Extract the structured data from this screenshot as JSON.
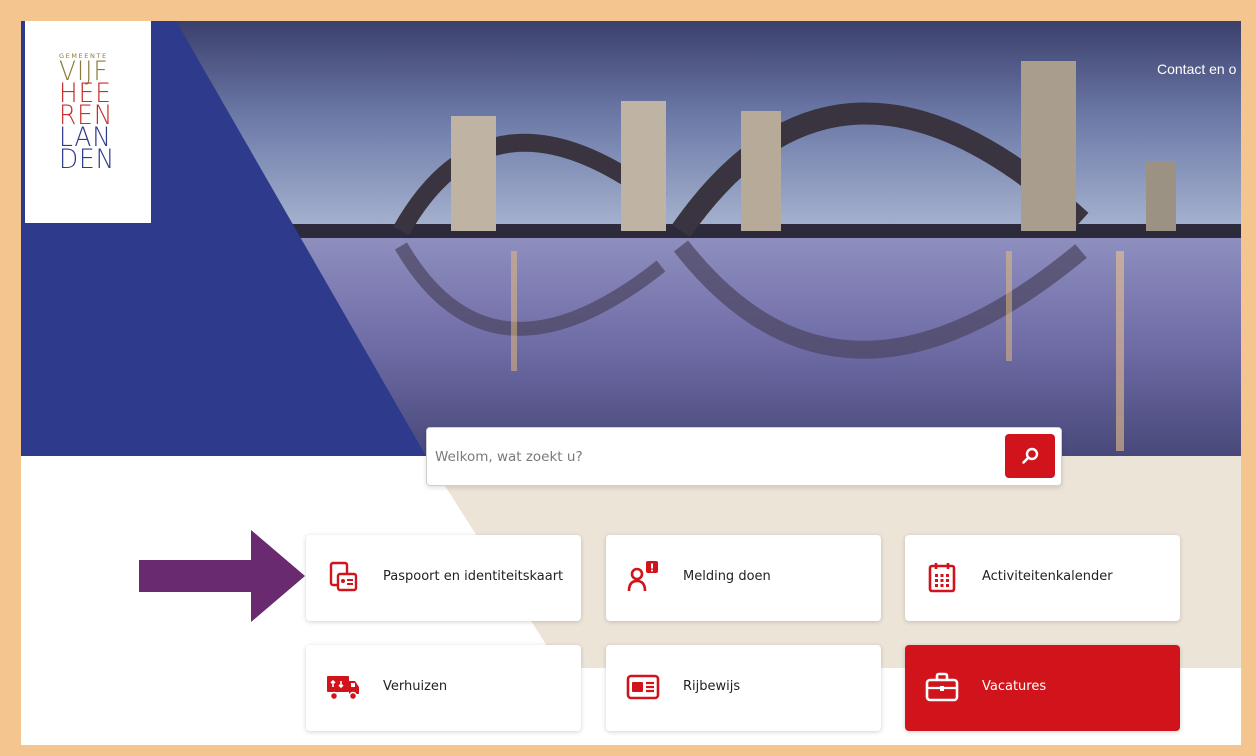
{
  "logo": {
    "small": "GEMEENTE",
    "line1": "VIJF",
    "line2": "HEE",
    "line3": "REN",
    "line4": "LAN",
    "line5": "DEN"
  },
  "header": {
    "contact_link": "Contact en o"
  },
  "search": {
    "placeholder": "Welkom, wat zoekt u?",
    "icon": "search-icon"
  },
  "tiles": [
    {
      "label": "Paspoort en identiteitskaart",
      "icon": "passport-id-icon"
    },
    {
      "label": "Melding doen",
      "icon": "report-person-icon"
    },
    {
      "label": "Activiteitenkalender",
      "icon": "calendar-icon"
    },
    {
      "label": "Verhuizen",
      "icon": "moving-truck-icon"
    },
    {
      "label": "Rijbewijs",
      "icon": "drivers-license-icon"
    },
    {
      "label": "Vacatures",
      "icon": "briefcase-icon"
    }
  ],
  "colors": {
    "brand_red": "#d1141c",
    "brand_blue": "#2e3a8c",
    "beige": "#ede4d8",
    "annotation_arrow": "#6a2a70",
    "frame": "#f4c58f"
  }
}
